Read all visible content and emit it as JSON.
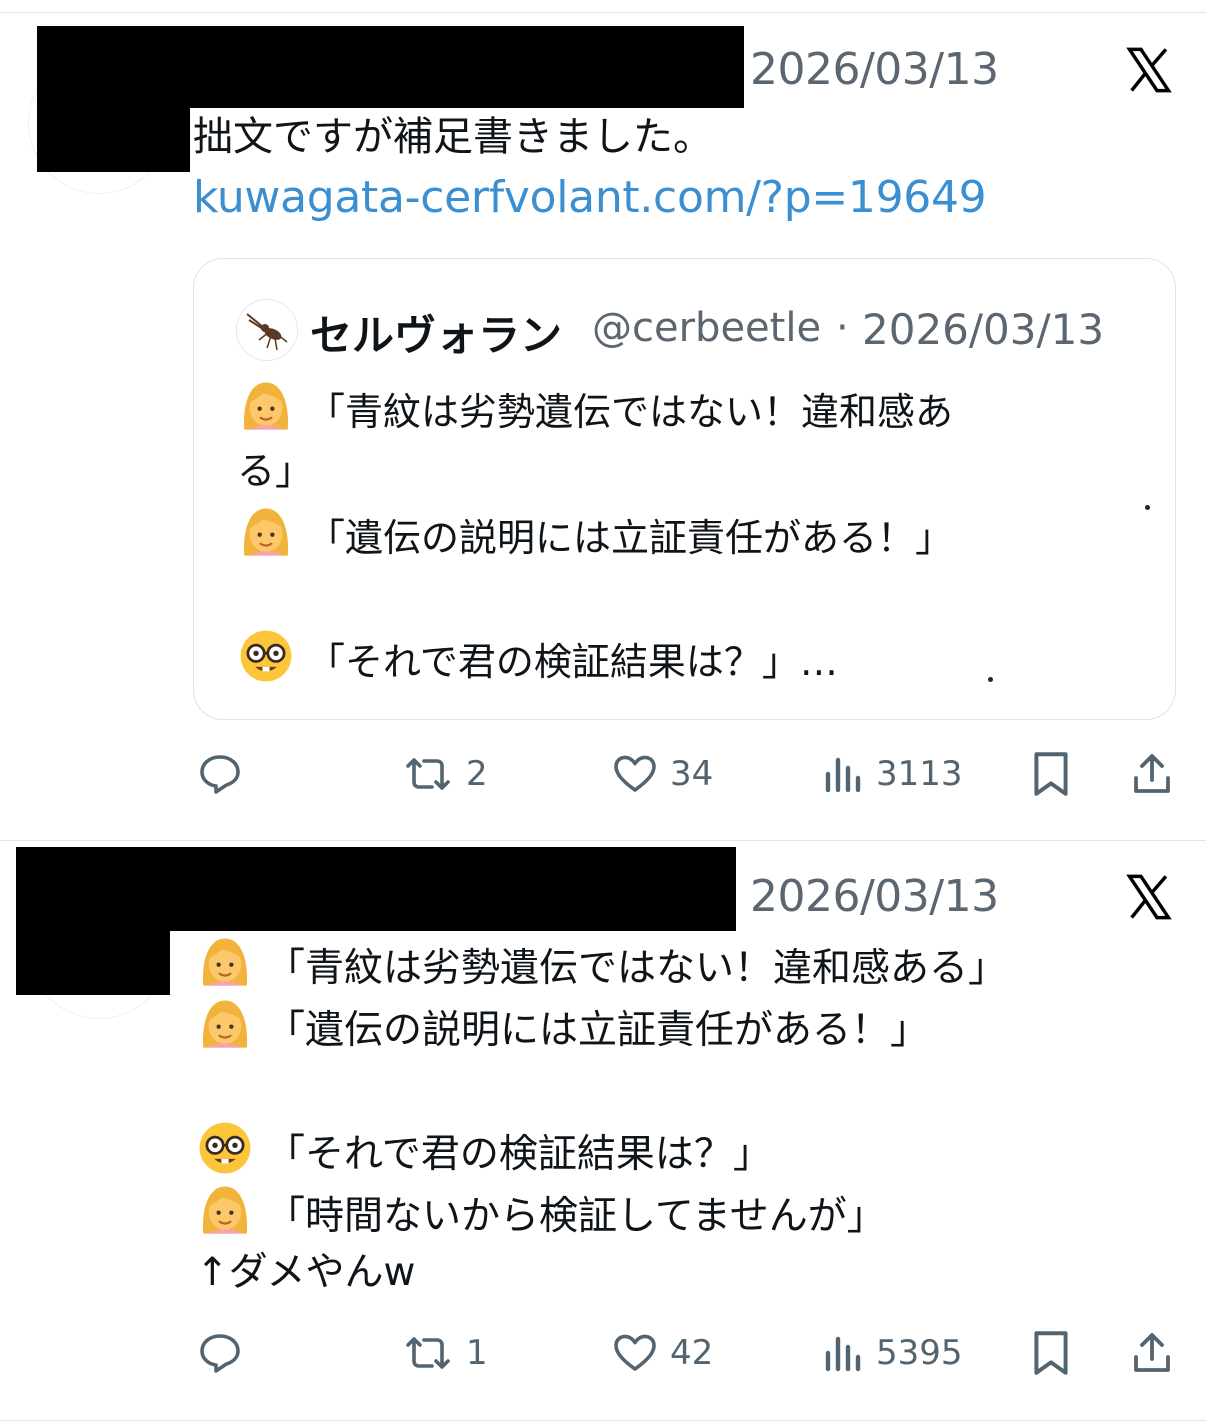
{
  "tweet1": {
    "date": "2026/03/13",
    "text": "拙文ですが補足書きました。",
    "link": "kuwagata-cerfvolant.com/?p=19649",
    "quote": {
      "name": "セルヴォラン",
      "handle": "@cerbeetle",
      "dot": "·",
      "date": "2026/03/13",
      "line1": "「青紋は劣勢遺伝ではない！違和感あ",
      "line1b": "る」",
      "line2": "「遺伝の説明には立証責任がある！」",
      "line3": "「それで君の検証結果は？」…"
    },
    "actions": {
      "reply": "",
      "retweet": "2",
      "like": "34",
      "views": "3113"
    }
  },
  "tweet2": {
    "date": "2026/03/13",
    "line1": "「青紋は劣勢遺伝ではない！違和感ある」",
    "line2": "「遺伝の説明には立証責任がある！」",
    "line3": "「それで君の検証結果は？」",
    "line4": "「時間ないから検証してませんが」",
    "line5": "↑ダメやんw",
    "actions": {
      "reply": "",
      "retweet": "1",
      "like": "42",
      "views": "5395"
    }
  },
  "icons": {
    "brand": "x-logo-icon",
    "reply": "reply-icon",
    "retweet": "retweet-icon",
    "like": "heart-icon",
    "views": "views-icon",
    "bookmark": "bookmark-icon",
    "share": "share-icon"
  },
  "colors": {
    "link": "#3b8fd0",
    "muted": "#536471",
    "text": "#0f1419",
    "border": "#dfe3e7"
  }
}
